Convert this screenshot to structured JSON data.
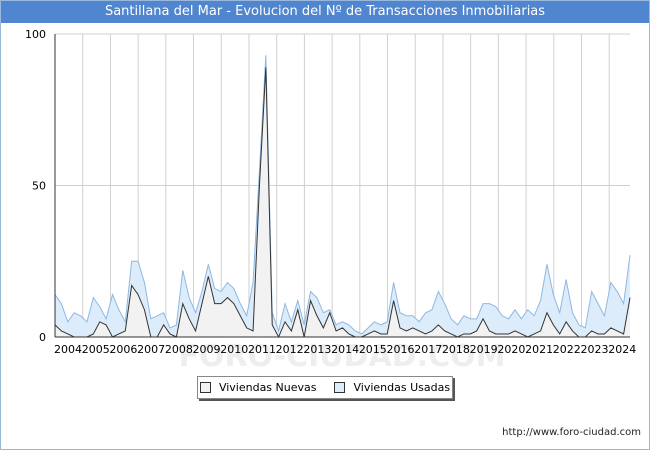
{
  "title": "Santillana del Mar - Evolucion del Nº de Transacciones Inmobiliarias",
  "footer_url": "http://www.foro-ciudad.com",
  "watermark": "FORO-CIUDAD.COM",
  "colors": {
    "title_bg": "#4f86cf",
    "nuevas_fill": "#f2f2f2",
    "nuevas_line": "#333333",
    "usadas_fill": "#dcecfa",
    "usadas_line": "#8db8e3"
  },
  "chart_data": {
    "type": "area",
    "ylim": [
      0,
      100
    ],
    "yticks": [
      "0",
      "50",
      "100"
    ],
    "x_tick_labels": [
      "2004",
      "2005",
      "2006",
      "2007",
      "2008",
      "2009",
      "2010",
      "2011",
      "2012",
      "2013",
      "2014",
      "2015",
      "2016",
      "2017",
      "2018",
      "2019",
      "2020",
      "2021",
      "2022",
      "2023",
      "2024"
    ],
    "x_range": [
      2004,
      2024.75
    ],
    "legend_position": "bottom-center",
    "series": [
      {
        "name": "Viviendas Nuevas",
        "key": "nuevas",
        "values": [
          4,
          2,
          1,
          0,
          0,
          0,
          1,
          5,
          4,
          0,
          1,
          2,
          17,
          14,
          9,
          0,
          0,
          4,
          1,
          0,
          11,
          6,
          2,
          11,
          20,
          11,
          11,
          13,
          11,
          7,
          3,
          2,
          50,
          89,
          4,
          0,
          5,
          2,
          9,
          0,
          12,
          7,
          3,
          8,
          2,
          3,
          1,
          0,
          0,
          1,
          2,
          1,
          1,
          12,
          3,
          2,
          3,
          2,
          1,
          2,
          4,
          2,
          1,
          0,
          1,
          1,
          2,
          6,
          2,
          1,
          1,
          1,
          2,
          1,
          0,
          1,
          2,
          8,
          4,
          1,
          5,
          2,
          0,
          0,
          2,
          1,
          1,
          3,
          2,
          1,
          13
        ]
      },
      {
        "name": "Viviendas Usadas",
        "key": "usadas",
        "values": [
          14,
          11,
          5,
          8,
          7,
          5,
          13,
          10,
          6,
          14,
          9,
          5,
          25,
          25,
          18,
          6,
          7,
          8,
          3,
          4,
          22,
          13,
          8,
          15,
          24,
          16,
          15,
          18,
          16,
          11,
          7,
          18,
          55,
          93,
          8,
          2,
          11,
          5,
          12,
          4,
          15,
          13,
          8,
          9,
          4,
          5,
          4,
          2,
          1,
          3,
          5,
          4,
          5,
          18,
          8,
          7,
          7,
          5,
          8,
          9,
          15,
          11,
          6,
          4,
          7,
          6,
          6,
          11,
          11,
          10,
          7,
          6,
          9,
          6,
          9,
          7,
          12,
          24,
          14,
          8,
          19,
          8,
          4,
          3,
          15,
          11,
          7,
          18,
          15,
          11,
          27
        ]
      }
    ]
  },
  "legend": {
    "nuevas_label": "Viviendas Nuevas",
    "usadas_label": "Viviendas Usadas"
  }
}
